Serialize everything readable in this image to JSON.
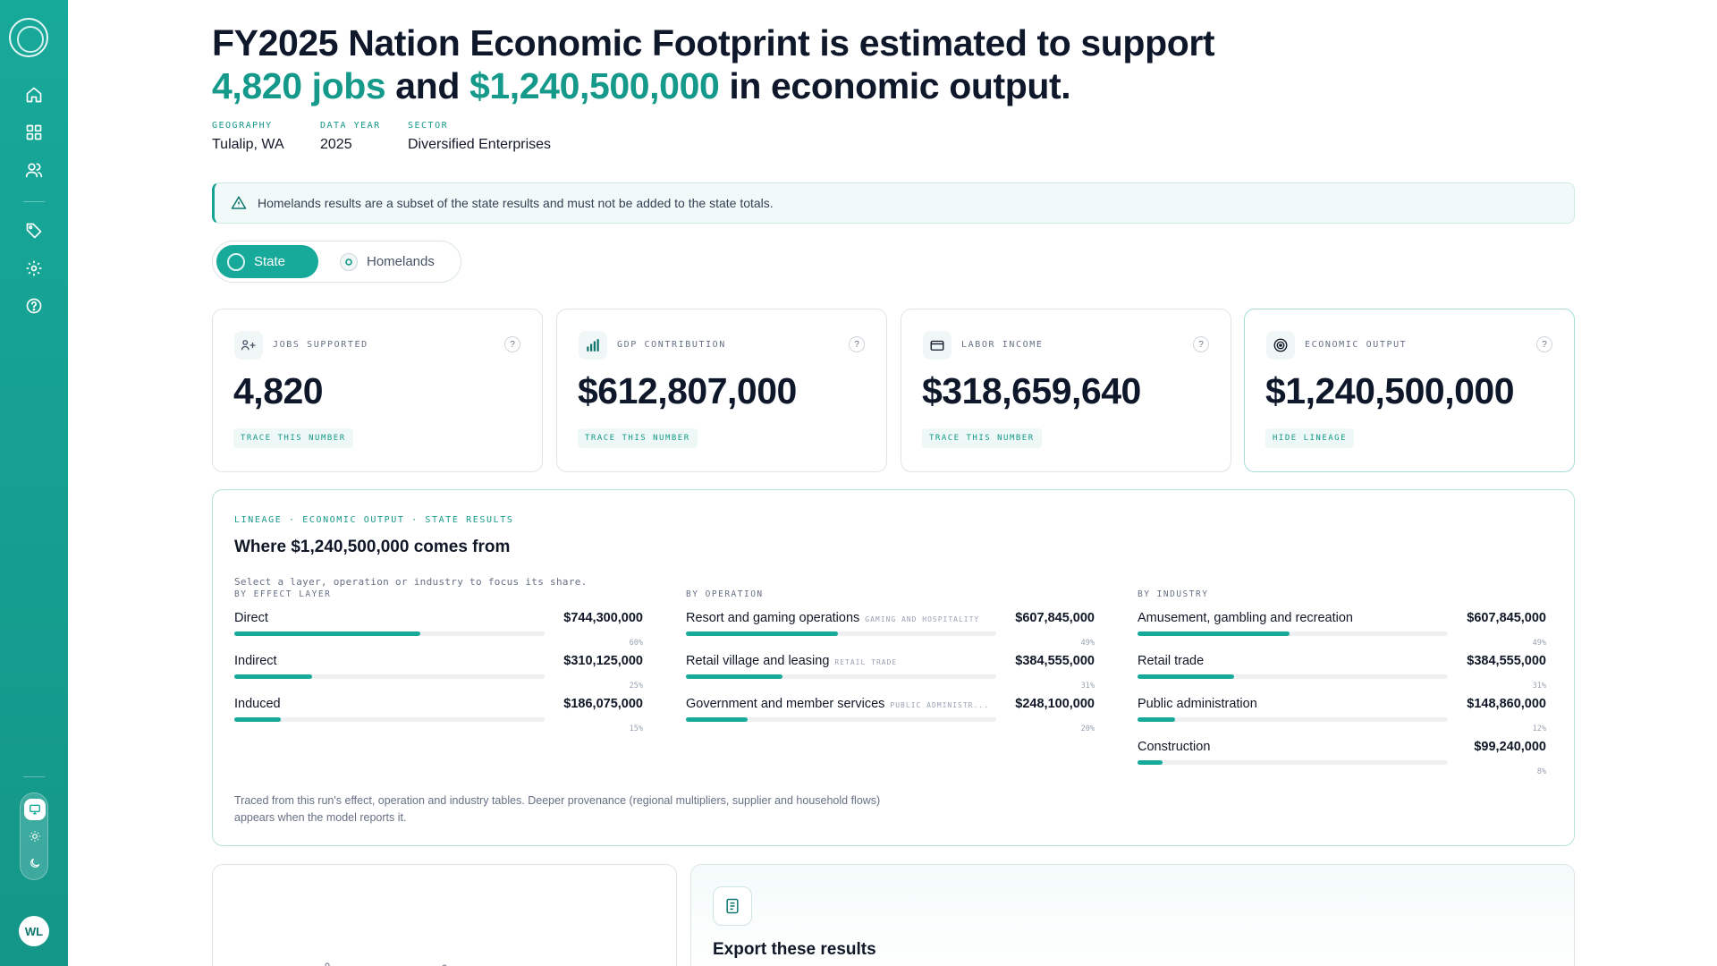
{
  "sidebar": {
    "nav_icons": [
      "home-icon",
      "grid-icon",
      "users-icon",
      "tag-icon",
      "gear-icon",
      "help-icon"
    ],
    "theme_options": [
      "monitor-icon",
      "sun-icon",
      "moon-icon"
    ],
    "avatar_initials": "WL"
  },
  "header": {
    "line1": "FY2025 Nation Economic Footprint is estimated to support",
    "jobs": "4,820 jobs",
    "and": "and",
    "output": "$1,240,500,000",
    "line2_end": "in economic output."
  },
  "meta": [
    {
      "label": "GEOGRAPHY",
      "value": "Tulalip, WA"
    },
    {
      "label": "DATA YEAR",
      "value": "2025"
    },
    {
      "label": "SECTOR",
      "value": "Diversified Enterprises"
    }
  ],
  "alert": {
    "text": "Homelands results are a subset of the state results and must not be added to the state totals."
  },
  "toggle": {
    "state": "State",
    "homelands": "Homelands"
  },
  "cards": [
    {
      "label": "JOBS SUPPORTED",
      "value": "4,820",
      "link": "TRACE THIS NUMBER",
      "icon": "jobs-icon"
    },
    {
      "label": "GDP CONTRIBUTION",
      "value": "$612,807,000",
      "link": "TRACE THIS NUMBER",
      "icon": "bar-chart-icon"
    },
    {
      "label": "LABOR INCOME",
      "value": "$318,659,640",
      "link": "TRACE THIS NUMBER",
      "icon": "wallet-icon"
    },
    {
      "label": "ECONOMIC OUTPUT",
      "value": "$1,240,500,000",
      "link": "HIDE LINEAGE",
      "icon": "target-icon"
    }
  ],
  "help_mark": "?",
  "lineage": {
    "crumb": "LINEAGE · ECONOMIC OUTPUT · STATE RESULTS",
    "title": "Where $1,240,500,000 comes from",
    "hint": "Select a layer, operation or industry to focus its share.",
    "columns": [
      {
        "heading": "BY EFFECT LAYER",
        "rows": [
          {
            "name": "Direct",
            "tag": "",
            "value": "$744,300,000",
            "pct": "60%",
            "share": 0.6
          },
          {
            "name": "Indirect",
            "tag": "",
            "value": "$310,125,000",
            "pct": "25%",
            "share": 0.25
          },
          {
            "name": "Induced",
            "tag": "",
            "value": "$186,075,000",
            "pct": "15%",
            "share": 0.15
          }
        ]
      },
      {
        "heading": "BY OPERATION",
        "rows": [
          {
            "name": "Resort and gaming operations",
            "tag": "GAMING AND HOSPITALITY",
            "value": "$607,845,000",
            "pct": "49%",
            "share": 0.49
          },
          {
            "name": "Retail village and leasing",
            "tag": "RETAIL TRADE",
            "value": "$384,555,000",
            "pct": "31%",
            "share": 0.31
          },
          {
            "name": "Government and member services",
            "tag": "PUBLIC ADMINISTR...",
            "value": "$248,100,000",
            "pct": "20%",
            "share": 0.2
          }
        ]
      },
      {
        "heading": "BY INDUSTRY",
        "rows": [
          {
            "name": "Amusement, gambling and recreation",
            "tag": "",
            "value": "$607,845,000",
            "pct": "49%",
            "share": 0.49
          },
          {
            "name": "Retail trade",
            "tag": "",
            "value": "$384,555,000",
            "pct": "31%",
            "share": 0.31
          },
          {
            "name": "Public administration",
            "tag": "",
            "value": "$148,860,000",
            "pct": "12%",
            "share": 0.12
          },
          {
            "name": "Construction",
            "tag": "",
            "value": "$99,240,000",
            "pct": "8%",
            "share": 0.08
          }
        ]
      }
    ],
    "footnote": "Traced from this run's effect, operation and industry tables. Deeper provenance (regional multipliers, supplier and household flows) appears when the model reports it."
  },
  "export": {
    "title": "Export these results",
    "icon": "document-icon"
  },
  "colors": {
    "accent": "#17a99a",
    "accent_text": "#15998a",
    "ink": "#0f172a"
  }
}
